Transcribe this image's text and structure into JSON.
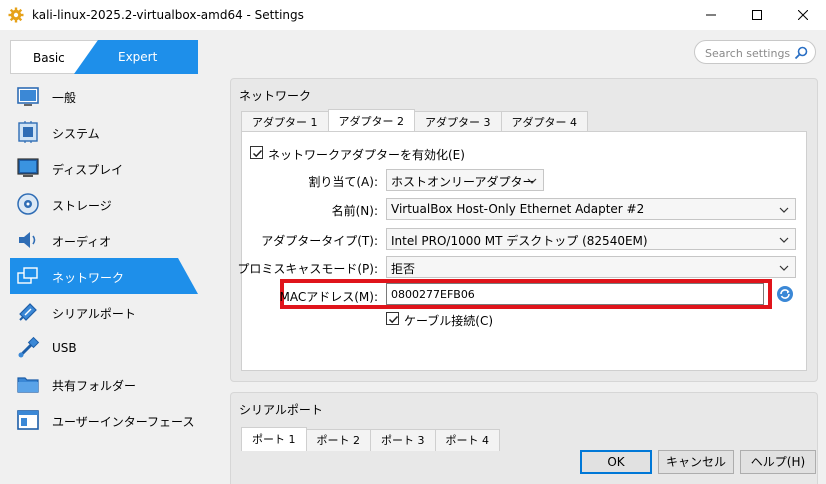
{
  "window": {
    "title": "kali-linux-2025.2-virtualbox-amd64 - Settings",
    "controls": {
      "minimize": "—",
      "maximize": "☐",
      "close": "✕"
    }
  },
  "mode_tabs": {
    "basic": "Basic",
    "expert": "Expert",
    "active": "Expert"
  },
  "search": {
    "placeholder": "Search settings"
  },
  "sidebar": {
    "active_index": 5,
    "items": [
      {
        "label": "一般",
        "icon": "general-icon"
      },
      {
        "label": "システム",
        "icon": "system-icon"
      },
      {
        "label": "ディスプレイ",
        "icon": "display-icon"
      },
      {
        "label": "ストレージ",
        "icon": "storage-icon"
      },
      {
        "label": "オーディオ",
        "icon": "audio-icon"
      },
      {
        "label": "ネットワーク",
        "icon": "network-icon"
      },
      {
        "label": "シリアルポート",
        "icon": "serial-port-icon"
      },
      {
        "label": "USB",
        "icon": "usb-icon"
      },
      {
        "label": "共有フォルダー",
        "icon": "shared-folder-icon"
      },
      {
        "label": "ユーザーインターフェース",
        "icon": "user-interface-icon"
      }
    ]
  },
  "network": {
    "section_title": "ネットワーク",
    "tabs": [
      "アダプター 1",
      "アダプター 2",
      "アダプター 3",
      "アダプター 4"
    ],
    "active_tab": 1,
    "enable_adapter": {
      "label": "ネットワークアダプターを有効化(E)",
      "checked": true
    },
    "attached_to": {
      "label": "割り当て(A):",
      "value": "ホストオンリーアダプター"
    },
    "name": {
      "label": "名前(N):",
      "value": "VirtualBox Host-Only Ethernet Adapter #2"
    },
    "adapter_type": {
      "label": "アダプタータイプ(T):",
      "value": "Intel PRO/1000 MT デスクトップ (82540EM)"
    },
    "promiscuous": {
      "label": "プロミスキャスモード(P):",
      "value": "拒否"
    },
    "mac": {
      "label": "MACアドレス(M):",
      "value": "0800277EFB06"
    },
    "cable_connected": {
      "label": "ケーブル接続(C)",
      "checked": true
    }
  },
  "serial": {
    "section_title": "シリアルポート",
    "tabs": [
      "ポート 1",
      "ポート 2",
      "ポート 3",
      "ポート 4"
    ],
    "active_tab": 0
  },
  "buttons": {
    "ok": "OK",
    "cancel": "キャンセル",
    "help": "ヘルプ(H)"
  },
  "colors": {
    "accent": "#1e8fea",
    "highlight": "#e0141b"
  }
}
